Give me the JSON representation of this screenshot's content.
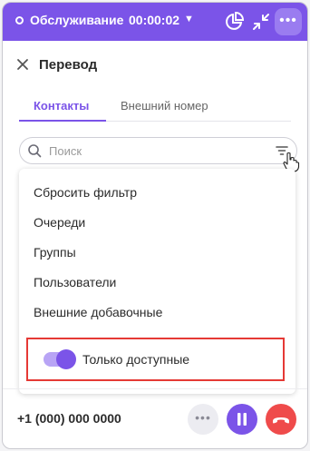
{
  "header": {
    "status_label": "Обслуживание",
    "timer": "00:00:02",
    "accent_color": "#7b54e8",
    "icons": [
      "status-ring-icon",
      "caret-down-icon",
      "pie-chart-icon",
      "minimize-icon",
      "more-icon"
    ]
  },
  "title": "Перевод",
  "tabs": [
    {
      "label": "Контакты",
      "active": true
    },
    {
      "label": "Внешний номер",
      "active": false
    }
  ],
  "search": {
    "placeholder": "Поиск",
    "value": ""
  },
  "filter_menu": {
    "items": [
      "Сбросить фильтр",
      "Очереди",
      "Группы",
      "Пользователи",
      "Внешние добавочные"
    ],
    "toggle": {
      "label": "Только доступные",
      "on": true
    }
  },
  "footer": {
    "phone": "+1 (000) 000 0000",
    "buttons": [
      "more-button",
      "pause-button",
      "hangup-button"
    ],
    "hangup_color": "#ef4b4b"
  }
}
